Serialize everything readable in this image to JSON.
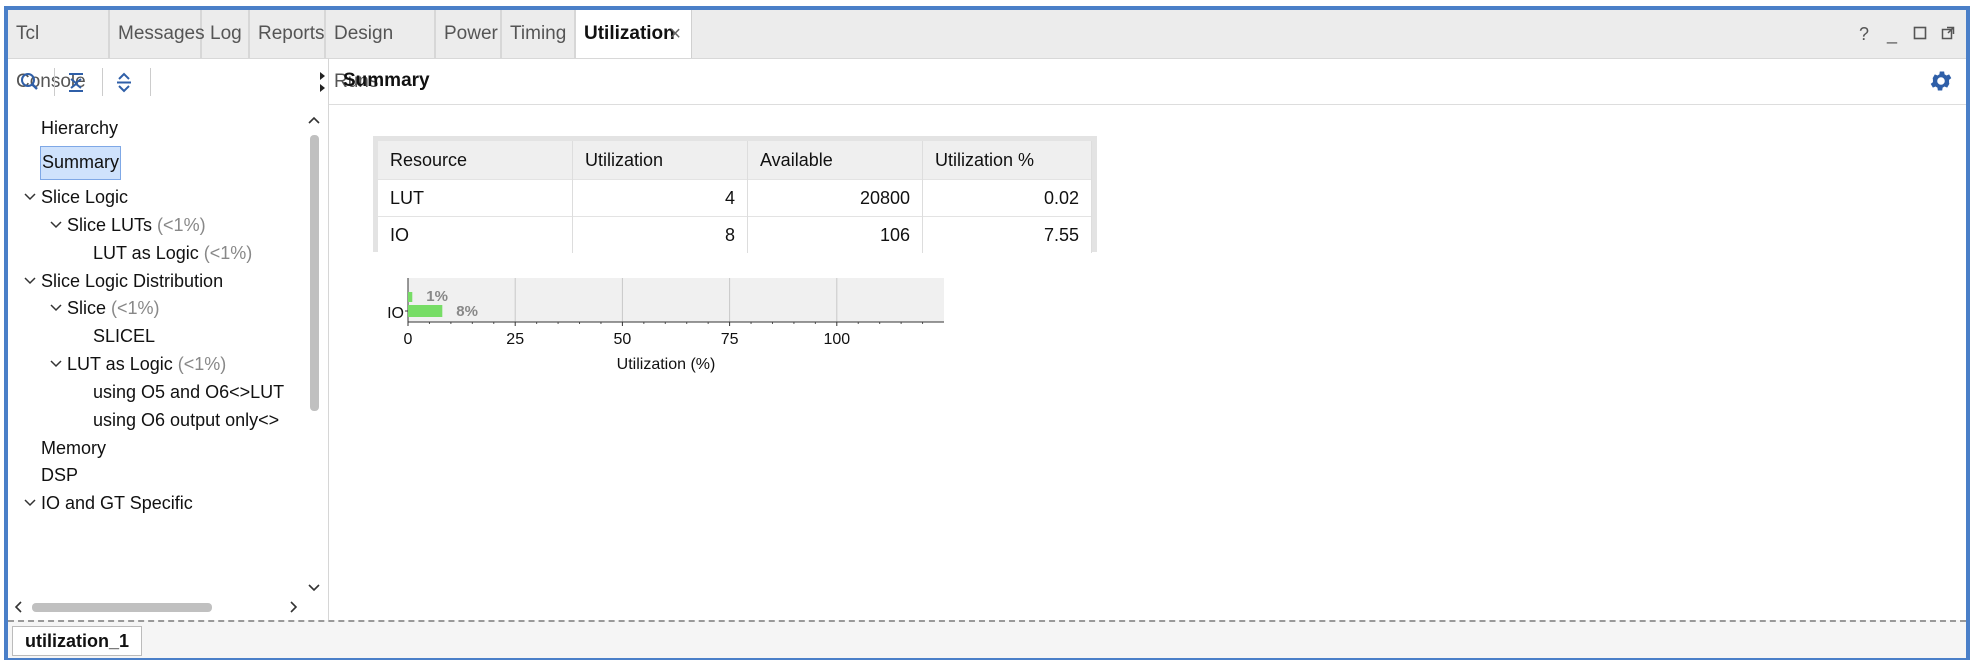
{
  "tabs": [
    {
      "label": "Tcl Console",
      "active": false
    },
    {
      "label": "Messages",
      "active": false
    },
    {
      "label": "Log",
      "active": false
    },
    {
      "label": "Reports",
      "active": false
    },
    {
      "label": "Design Runs",
      "active": false
    },
    {
      "label": "Power",
      "active": false
    },
    {
      "label": "Timing",
      "active": false
    },
    {
      "label": "Utilization",
      "active": true
    }
  ],
  "window_controls": {
    "help": "?",
    "minimize": "_"
  },
  "tree": {
    "nodes": [
      {
        "label": "Hierarchy",
        "pct": "",
        "selected": false,
        "expander": ""
      },
      {
        "label": "Summary",
        "pct": "",
        "selected": true,
        "expander": ""
      },
      {
        "label": "Slice Logic",
        "pct": "",
        "selected": false,
        "expander": "expanded"
      },
      {
        "label": "Slice LUTs",
        "pct": "(<1%)",
        "selected": false,
        "expander": "expanded"
      },
      {
        "label": "LUT as Logic",
        "pct": "(<1%)",
        "selected": false,
        "expander": ""
      },
      {
        "label": "Slice Logic Distribution",
        "pct": "",
        "selected": false,
        "expander": "expanded"
      },
      {
        "label": "Slice",
        "pct": "(<1%)",
        "selected": false,
        "expander": "expanded"
      },
      {
        "label": "SLICEL",
        "pct": "",
        "selected": false,
        "expander": ""
      },
      {
        "label": "LUT as Logic",
        "pct": "(<1%)",
        "selected": false,
        "expander": "expanded"
      },
      {
        "label": "using O5 and O6<>LUT",
        "pct": "",
        "selected": false,
        "expander": ""
      },
      {
        "label": "using O6 output only<>",
        "pct": "",
        "selected": false,
        "expander": ""
      },
      {
        "label": "Memory",
        "pct": "",
        "selected": false,
        "expander": ""
      },
      {
        "label": "DSP",
        "pct": "",
        "selected": false,
        "expander": ""
      },
      {
        "label": "IO and GT Specific",
        "pct": "",
        "selected": false,
        "expander": "expanded"
      }
    ]
  },
  "main": {
    "title": "Summary",
    "table": {
      "headers": [
        "Resource",
        "Utilization",
        "Available",
        "Utilization %"
      ],
      "rows": [
        [
          "LUT",
          "4",
          "20800",
          "0.02"
        ],
        [
          "IO",
          "8",
          "106",
          "7.55"
        ]
      ]
    }
  },
  "chart_data": {
    "type": "bar",
    "orientation": "horizontal",
    "categories": [
      "LUT",
      "IO"
    ],
    "category_labels_shown": [
      "",
      "IO"
    ],
    "values": [
      1,
      8
    ],
    "data_labels": [
      "1%",
      "8%"
    ],
    "xlabel": "Utilization (%)",
    "xlim": [
      0,
      125
    ],
    "xticks": [
      0,
      25,
      50,
      75,
      100
    ],
    "grid": true,
    "bar_color": "#77dd66"
  },
  "status": {
    "tab_label": "utilization_1"
  },
  "colors": {
    "accent": "#4a7fc8",
    "selection": "#cfe2fc",
    "bar": "#77dd66"
  }
}
